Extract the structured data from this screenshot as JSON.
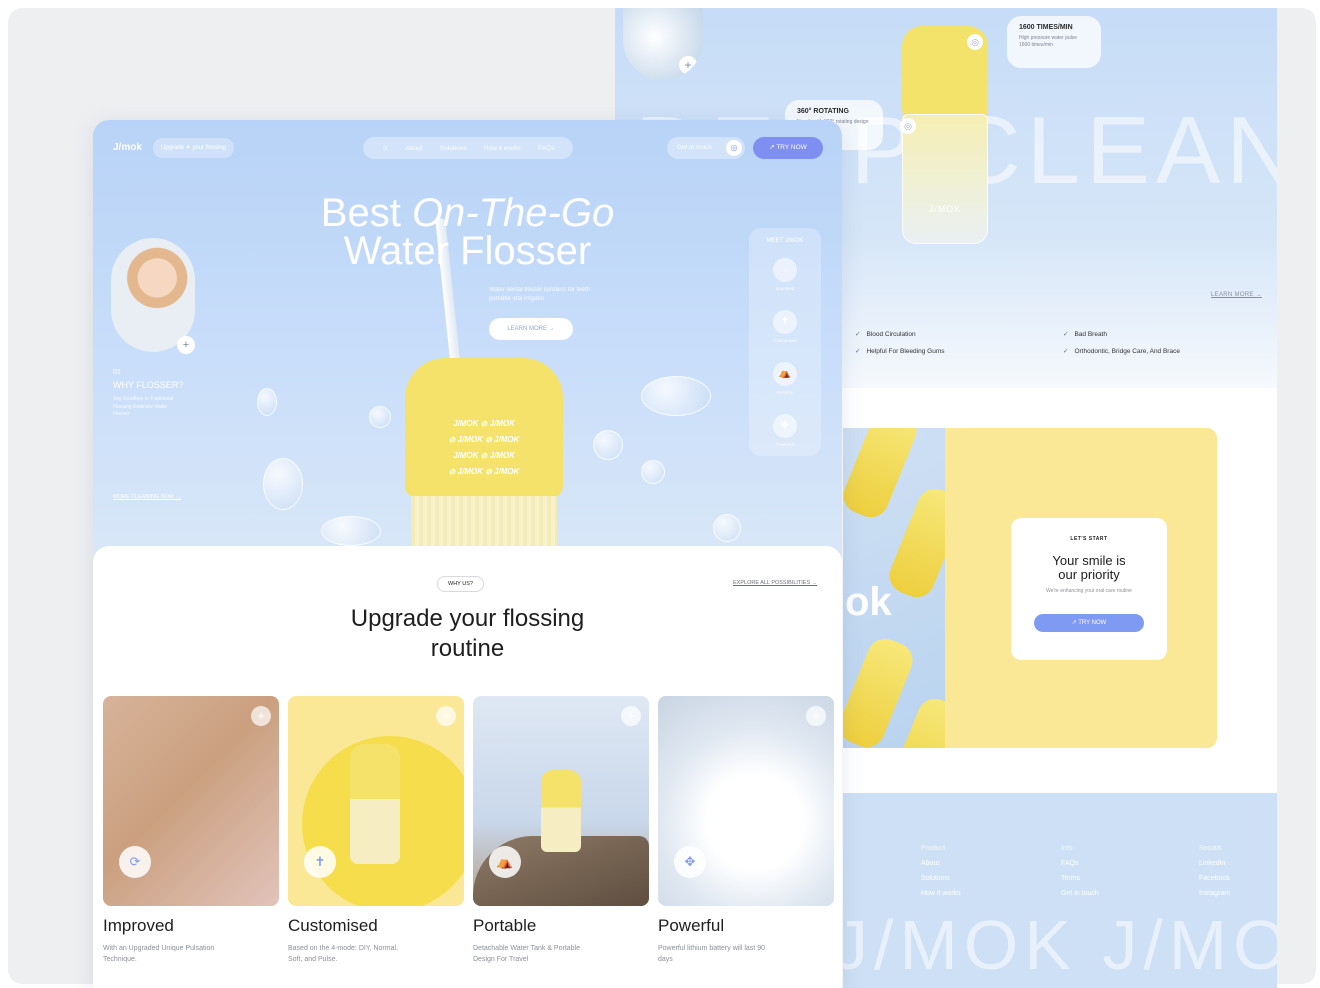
{
  "back": {
    "hero_word": "DEEP CLEAN",
    "callout_1": {
      "title": "1600 TIMES/MIN",
      "sub": "High pressure water pulse 1600 times/min"
    },
    "callout_2": {
      "title": "360° ROTATING",
      "sub": "Nozzle with 360° rotating design"
    },
    "device_brand": "J/MOK",
    "learn_more": "LEARN MORE →",
    "benefits": [
      "Blood Circulation",
      "Helpful For Bleeding Gums",
      "Bad Breath",
      "Orthodontic, Bridge Care, And Brace"
    ],
    "mid_brand": "ok",
    "smile_card": {
      "label": "LET'S START",
      "title_1": "Your smile is",
      "title_2": "our priority",
      "sub": "We're enhancing your oral care routine",
      "button": "↗  TRY NOW"
    },
    "footer": {
      "col1": {
        "head": "Product",
        "items": [
          "About",
          "Solutions",
          "How it works"
        ]
      },
      "col2": {
        "head": "Info",
        "items": [
          "FAQs",
          "Terms",
          "Get in touch"
        ]
      },
      "col3": {
        "head": "Socials",
        "items": [
          "LinkedIn",
          "Facebook",
          "Instagram"
        ]
      },
      "word": "J/MOK J/MOK"
    }
  },
  "front": {
    "nav": {
      "logo": "J/mok",
      "tag": "Upgrade ✦ your flossing",
      "links": [
        "☺",
        "About",
        "Solutions",
        "How it works",
        "FAQs"
      ],
      "get_in_touch": "Get in touch",
      "try_now": "↗  TRY NOW"
    },
    "hero": {
      "title_1": "Best",
      "title_italic": "On-The-Go",
      "title_2": "Water Flosser",
      "sub": "Water dental flosser cordless for teeth portable oral irrigator",
      "learn_more": "LEARN MORE →",
      "why_num": "01",
      "why_title": "WHY FLOSSER?",
      "why_desc": "Say Goodbye to Traditional Flossing Embrace Water Flosser",
      "more_link": "MORE CLEANING NOW →",
      "device_band": [
        "J/MOK ⊘ J/MOK",
        "⊘ J/MOK ⊘ J/MOK",
        "J/MOK ⊘ J/MOK",
        "⊘ J/MOK ⊘ J/MOK"
      ]
    },
    "side_menu": {
      "title": "MEET J/MOK",
      "items": [
        {
          "icon": "◌",
          "label": "Improved"
        },
        {
          "icon": "✝",
          "label": "Customised"
        },
        {
          "icon": "⛺",
          "label": "Portable"
        },
        {
          "icon": "✥",
          "label": "Powerful"
        }
      ]
    },
    "section": {
      "pill": "WHY US?",
      "explore": "EXPLORE ALL POSSIBILITIES →",
      "title_1": "Upgrade your flossing",
      "title_2": "routine"
    },
    "cards": [
      {
        "title": "Improved",
        "desc": "With an Upgraded Unique Pulsation Technique.",
        "icon": "⟳"
      },
      {
        "title": "Customised",
        "desc": "Based on the 4-mode: DIY, Normal, Soft, and Pulse.",
        "icon": "✝"
      },
      {
        "title": "Portable",
        "desc": "Detachable Water Tank & Portable Design For Travel",
        "icon": "⛺"
      },
      {
        "title": "Powerful",
        "desc": "Powerful lithium battery will last 90 days",
        "icon": "✥"
      }
    ]
  },
  "colors": {
    "sky": "#b8d3f7",
    "accent": "#7f8ff1",
    "yellow": "#f5e26a",
    "pale_yellow": "#fbe897"
  }
}
